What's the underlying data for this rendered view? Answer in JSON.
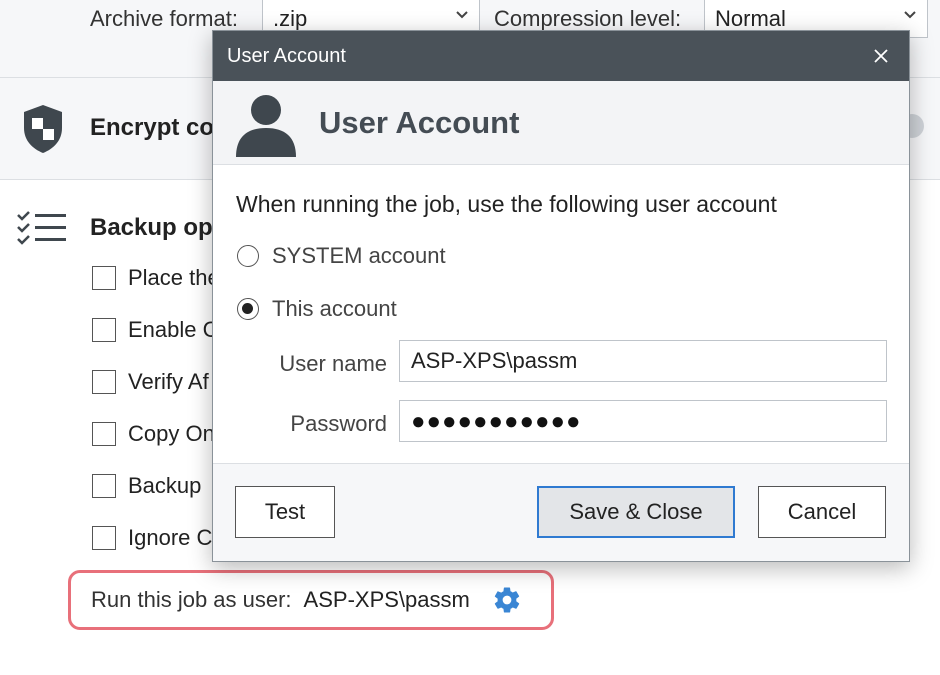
{
  "background": {
    "archive_format_label": "Archive format:",
    "archive_format_value": ".zip",
    "compression_level_label": "Compression level:",
    "compression_level_value": "Normal",
    "encrypt_title": "Encrypt co",
    "backup_options_title": "Backup op",
    "options": [
      {
        "label": "Place the"
      },
      {
        "label": "Enable C"
      },
      {
        "label": "Verify Af"
      },
      {
        "label": "Copy On"
      },
      {
        "label": "Backup"
      },
      {
        "label": "Ignore C"
      }
    ],
    "run_as_label": "Run this job as user:",
    "run_as_value": "ASP-XPS\\passm"
  },
  "dialog": {
    "window_title": "User Account",
    "header_title": "User Account",
    "instruction": "When running the job, use the following user account",
    "radio_system": "SYSTEM account",
    "radio_this": "This account",
    "selected": "this",
    "username_label": "User name",
    "username_value": "ASP-XPS\\passm",
    "password_label": "Password",
    "password_mask": "●●●●●●●●●●●",
    "buttons": {
      "test": "Test",
      "save_close": "Save & Close",
      "cancel": "Cancel"
    }
  },
  "colors": {
    "titlebar": "#4a5259",
    "accent": "#2f7ad1",
    "highlight_border": "#e8707a",
    "gear": "#3a86d4"
  },
  "icons": [
    "shield-icon",
    "checklist-icon",
    "gear-icon",
    "user-icon",
    "close-icon",
    "chevron-down-icon"
  ]
}
